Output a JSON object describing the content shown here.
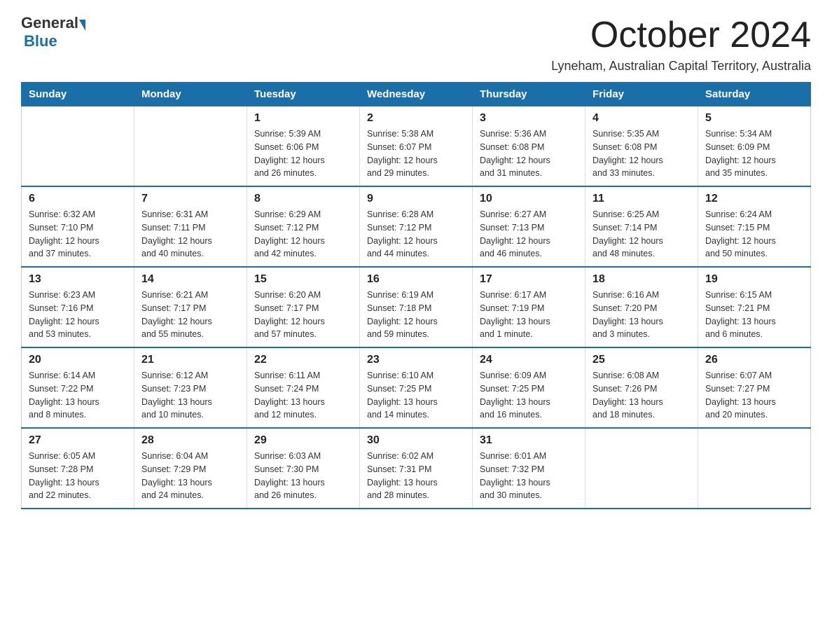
{
  "header": {
    "logo_general": "General",
    "logo_blue": "Blue",
    "month_title": "October 2024",
    "location": "Lyneham, Australian Capital Territory, Australia"
  },
  "calendar": {
    "days_of_week": [
      "Sunday",
      "Monday",
      "Tuesday",
      "Wednesday",
      "Thursday",
      "Friday",
      "Saturday"
    ],
    "weeks": [
      [
        {
          "day": "",
          "info": ""
        },
        {
          "day": "",
          "info": ""
        },
        {
          "day": "1",
          "info": "Sunrise: 5:39 AM\nSunset: 6:06 PM\nDaylight: 12 hours\nand 26 minutes."
        },
        {
          "day": "2",
          "info": "Sunrise: 5:38 AM\nSunset: 6:07 PM\nDaylight: 12 hours\nand 29 minutes."
        },
        {
          "day": "3",
          "info": "Sunrise: 5:36 AM\nSunset: 6:08 PM\nDaylight: 12 hours\nand 31 minutes."
        },
        {
          "day": "4",
          "info": "Sunrise: 5:35 AM\nSunset: 6:08 PM\nDaylight: 12 hours\nand 33 minutes."
        },
        {
          "day": "5",
          "info": "Sunrise: 5:34 AM\nSunset: 6:09 PM\nDaylight: 12 hours\nand 35 minutes."
        }
      ],
      [
        {
          "day": "6",
          "info": "Sunrise: 6:32 AM\nSunset: 7:10 PM\nDaylight: 12 hours\nand 37 minutes."
        },
        {
          "day": "7",
          "info": "Sunrise: 6:31 AM\nSunset: 7:11 PM\nDaylight: 12 hours\nand 40 minutes."
        },
        {
          "day": "8",
          "info": "Sunrise: 6:29 AM\nSunset: 7:12 PM\nDaylight: 12 hours\nand 42 minutes."
        },
        {
          "day": "9",
          "info": "Sunrise: 6:28 AM\nSunset: 7:12 PM\nDaylight: 12 hours\nand 44 minutes."
        },
        {
          "day": "10",
          "info": "Sunrise: 6:27 AM\nSunset: 7:13 PM\nDaylight: 12 hours\nand 46 minutes."
        },
        {
          "day": "11",
          "info": "Sunrise: 6:25 AM\nSunset: 7:14 PM\nDaylight: 12 hours\nand 48 minutes."
        },
        {
          "day": "12",
          "info": "Sunrise: 6:24 AM\nSunset: 7:15 PM\nDaylight: 12 hours\nand 50 minutes."
        }
      ],
      [
        {
          "day": "13",
          "info": "Sunrise: 6:23 AM\nSunset: 7:16 PM\nDaylight: 12 hours\nand 53 minutes."
        },
        {
          "day": "14",
          "info": "Sunrise: 6:21 AM\nSunset: 7:17 PM\nDaylight: 12 hours\nand 55 minutes."
        },
        {
          "day": "15",
          "info": "Sunrise: 6:20 AM\nSunset: 7:17 PM\nDaylight: 12 hours\nand 57 minutes."
        },
        {
          "day": "16",
          "info": "Sunrise: 6:19 AM\nSunset: 7:18 PM\nDaylight: 12 hours\nand 59 minutes."
        },
        {
          "day": "17",
          "info": "Sunrise: 6:17 AM\nSunset: 7:19 PM\nDaylight: 13 hours\nand 1 minute."
        },
        {
          "day": "18",
          "info": "Sunrise: 6:16 AM\nSunset: 7:20 PM\nDaylight: 13 hours\nand 3 minutes."
        },
        {
          "day": "19",
          "info": "Sunrise: 6:15 AM\nSunset: 7:21 PM\nDaylight: 13 hours\nand 6 minutes."
        }
      ],
      [
        {
          "day": "20",
          "info": "Sunrise: 6:14 AM\nSunset: 7:22 PM\nDaylight: 13 hours\nand 8 minutes."
        },
        {
          "day": "21",
          "info": "Sunrise: 6:12 AM\nSunset: 7:23 PM\nDaylight: 13 hours\nand 10 minutes."
        },
        {
          "day": "22",
          "info": "Sunrise: 6:11 AM\nSunset: 7:24 PM\nDaylight: 13 hours\nand 12 minutes."
        },
        {
          "day": "23",
          "info": "Sunrise: 6:10 AM\nSunset: 7:25 PM\nDaylight: 13 hours\nand 14 minutes."
        },
        {
          "day": "24",
          "info": "Sunrise: 6:09 AM\nSunset: 7:25 PM\nDaylight: 13 hours\nand 16 minutes."
        },
        {
          "day": "25",
          "info": "Sunrise: 6:08 AM\nSunset: 7:26 PM\nDaylight: 13 hours\nand 18 minutes."
        },
        {
          "day": "26",
          "info": "Sunrise: 6:07 AM\nSunset: 7:27 PM\nDaylight: 13 hours\nand 20 minutes."
        }
      ],
      [
        {
          "day": "27",
          "info": "Sunrise: 6:05 AM\nSunset: 7:28 PM\nDaylight: 13 hours\nand 22 minutes."
        },
        {
          "day": "28",
          "info": "Sunrise: 6:04 AM\nSunset: 7:29 PM\nDaylight: 13 hours\nand 24 minutes."
        },
        {
          "day": "29",
          "info": "Sunrise: 6:03 AM\nSunset: 7:30 PM\nDaylight: 13 hours\nand 26 minutes."
        },
        {
          "day": "30",
          "info": "Sunrise: 6:02 AM\nSunset: 7:31 PM\nDaylight: 13 hours\nand 28 minutes."
        },
        {
          "day": "31",
          "info": "Sunrise: 6:01 AM\nSunset: 7:32 PM\nDaylight: 13 hours\nand 30 minutes."
        },
        {
          "day": "",
          "info": ""
        },
        {
          "day": "",
          "info": ""
        }
      ]
    ]
  }
}
